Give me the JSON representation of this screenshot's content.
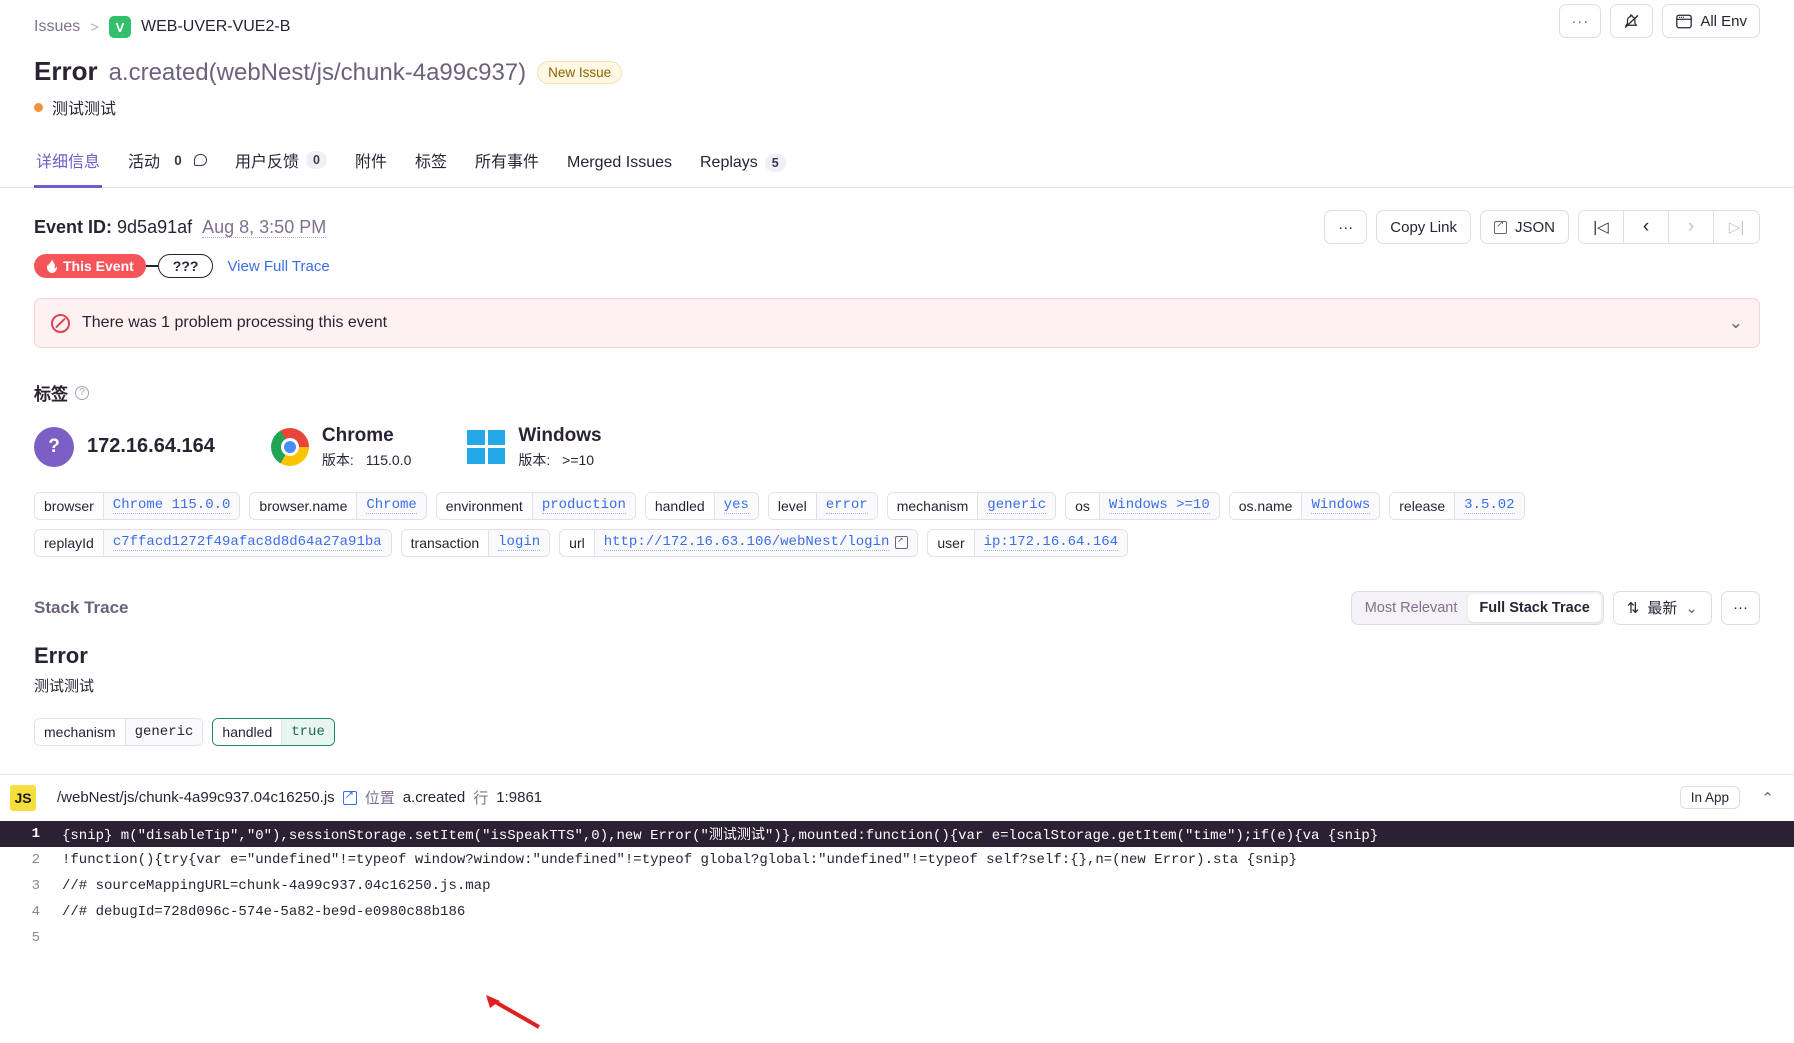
{
  "header": {
    "breadcrumb_root": "Issues",
    "breadcrumb_sep": ">",
    "project_badge": "V",
    "project_name": "WEB-UVER-VUE2-B",
    "more_label": "···",
    "mute_icon": "bell-muted-icon",
    "env_label": "All Env",
    "title_type": "Error",
    "title_location": "a.created(webNest/js/chunk-4a99c937)",
    "new_issue_badge": "New Issue",
    "culprit": "测试测试"
  },
  "tabs": [
    {
      "label": "详细信息",
      "count": null,
      "active": true
    },
    {
      "label": "活动",
      "count": "0",
      "active": false
    },
    {
      "label": "用户反馈",
      "count": "0",
      "active": false
    },
    {
      "label": "附件",
      "count": null,
      "active": false
    },
    {
      "label": "标签",
      "count": null,
      "active": false
    },
    {
      "label": "所有事件",
      "count": null,
      "active": false
    },
    {
      "label": "Merged Issues",
      "count": null,
      "active": false
    },
    {
      "label": "Replays",
      "count": "5",
      "active": false
    }
  ],
  "event": {
    "id_label": "Event ID:",
    "id_value": "9d5a91af",
    "date": "Aug 8, 3:50 PM",
    "more_label": "···",
    "copy_link": "Copy Link",
    "json": "JSON",
    "nav_first": "|◁",
    "nav_prev": "‹",
    "nav_next": "›",
    "nav_last": "▷|",
    "this_event": "This Event",
    "this_event_icon": "fire-icon",
    "unknown_span": "???",
    "view_full_trace": "View Full Trace"
  },
  "problem_banner": {
    "icon": "no-entry-icon",
    "text": "There was 1 problem processing this event",
    "chevron": "⌄"
  },
  "tags_section": {
    "title": "标签",
    "help_icon": "question-circle-icon",
    "summary": [
      {
        "type": "ip",
        "icon": "question-avatar",
        "icon_text": "?",
        "title": "172.16.64.164",
        "sub_key": null,
        "sub_value": null
      },
      {
        "type": "browser",
        "icon": "chrome-icon",
        "title": "Chrome",
        "sub_key": "版本:",
        "sub_value": "115.0.0"
      },
      {
        "type": "os",
        "icon": "windows-icon",
        "title": "Windows",
        "sub_key": "版本:",
        "sub_value": ">=10"
      }
    ],
    "pills": [
      {
        "key": "browser",
        "value": "Chrome 115.0.0",
        "link": true,
        "external": false
      },
      {
        "key": "browser.name",
        "value": "Chrome",
        "link": true,
        "external": false
      },
      {
        "key": "environment",
        "value": "production",
        "link": true,
        "external": false
      },
      {
        "key": "handled",
        "value": "yes",
        "link": true,
        "external": false
      },
      {
        "key": "level",
        "value": "error",
        "link": true,
        "external": false
      },
      {
        "key": "mechanism",
        "value": "generic",
        "link": true,
        "external": false
      },
      {
        "key": "os",
        "value": "Windows >=10",
        "link": true,
        "external": false
      },
      {
        "key": "os.name",
        "value": "Windows",
        "link": true,
        "external": false
      },
      {
        "key": "release",
        "value": "3.5.02",
        "link": true,
        "external": false
      },
      {
        "key": "replayId",
        "value": "c7ffacd1272f49afac8d8d64a27a91ba",
        "link": true,
        "external": false
      },
      {
        "key": "transaction",
        "value": "login",
        "link": true,
        "external": false
      },
      {
        "key": "url",
        "value": "http://172.16.63.106/webNest/login",
        "link": true,
        "external": true
      },
      {
        "key": "user",
        "value": "ip:172.16.64.164",
        "link": true,
        "external": false
      }
    ]
  },
  "stack_trace": {
    "title": "Stack Trace",
    "controls": {
      "most_relevant": "Most Relevant",
      "full_stack_trace": "Full Stack Trace",
      "sort_icon": "sort-arrows-icon",
      "sort_label": "最新",
      "sort_chevron": "⌄",
      "more_label": "···"
    },
    "error_heading": "Error",
    "error_message": "测试测试",
    "mech_pills": [
      {
        "key": "mechanism",
        "value": "generic",
        "ok": false
      },
      {
        "key": "handled",
        "value": "true",
        "ok": true
      }
    ],
    "frame": {
      "lang_badge": "JS",
      "path": "/webNest/js/chunk-4a99c937.04c16250.js",
      "external_icon": "external-link-icon",
      "in_label": "位置",
      "function": "a.created",
      "line_label": "行",
      "line_value": "1:9861",
      "in_app": "In App",
      "chevron": "⌃",
      "lines": [
        {
          "no": "1",
          "text": "{snip} m(\"disableTip\",\"0\"),sessionStorage.setItem(\"isSpeakTTS\",0),new Error(\"测试测试\")},mounted:function(){var e=localStorage.getItem(\"time\");if(e){va {snip}",
          "highlight": true
        },
        {
          "no": "2",
          "text": "!function(){try{var e=\"undefined\"!=typeof window?window:\"undefined\"!=typeof global?global:\"undefined\"!=typeof self?self:{},n=(new Error).sta {snip}",
          "highlight": false
        },
        {
          "no": "3",
          "text": "//# sourceMappingURL=chunk-4a99c937.04c16250.js.map",
          "highlight": false
        },
        {
          "no": "4",
          "text": "//# debugId=728d096c-574e-5a82-be9d-e0980c88b186",
          "highlight": false
        },
        {
          "no": "5",
          "text": "",
          "highlight": false
        }
      ]
    }
  }
}
